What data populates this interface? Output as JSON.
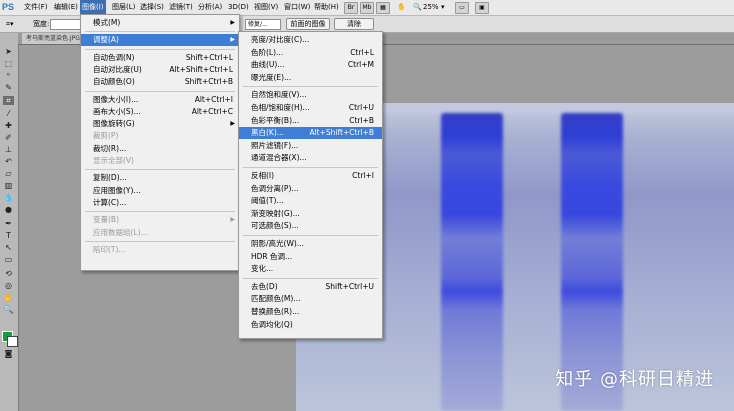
{
  "menubar": {
    "app_logo": "PS",
    "items": [
      {
        "label": "文件(F)"
      },
      {
        "label": "编辑(E)"
      },
      {
        "label": "图像(I)"
      },
      {
        "label": "图层(L)"
      },
      {
        "label": "选择(S)"
      },
      {
        "label": "滤镜(T)"
      },
      {
        "label": "分析(A)"
      },
      {
        "label": "3D(D)"
      },
      {
        "label": "视图(V)"
      },
      {
        "label": "窗口(W)"
      },
      {
        "label": "帮助(H)"
      }
    ],
    "zoom": "25%"
  },
  "options_bar": {
    "width_label": "宽度:",
    "style_value": "修复/...",
    "front_image_button": "前面的图像",
    "clear_button": "清除"
  },
  "document_tab": {
    "title": "考马斯亮蓝染色.JPG"
  },
  "image_menu": {
    "items": [
      {
        "label": "模式(M)",
        "shortcut": "",
        "submenu": true,
        "highlighted": false,
        "disabled": false
      },
      {
        "separator": true
      },
      {
        "label": "调整(A)",
        "shortcut": "",
        "submenu": true,
        "highlighted": true,
        "disabled": false
      },
      {
        "separator": true
      },
      {
        "label": "自动色调(N)",
        "shortcut": "Shift+Ctrl+L",
        "submenu": false,
        "highlighted": false,
        "disabled": false
      },
      {
        "label": "自动对比度(U)",
        "shortcut": "Alt+Shift+Ctrl+L",
        "submenu": false,
        "highlighted": false,
        "disabled": false
      },
      {
        "label": "自动颜色(O)",
        "shortcut": "Shift+Ctrl+B",
        "submenu": false,
        "highlighted": false,
        "disabled": false
      },
      {
        "separator": true
      },
      {
        "label": "图像大小(I)...",
        "shortcut": "Alt+Ctrl+I",
        "submenu": false,
        "highlighted": false,
        "disabled": false
      },
      {
        "label": "画布大小(S)...",
        "shortcut": "Alt+Ctrl+C",
        "submenu": false,
        "highlighted": false,
        "disabled": false
      },
      {
        "label": "图像旋转(G)",
        "shortcut": "",
        "submenu": true,
        "highlighted": false,
        "disabled": false
      },
      {
        "label": "裁剪(P)",
        "shortcut": "",
        "submenu": false,
        "highlighted": false,
        "disabled": true
      },
      {
        "label": "裁切(R)...",
        "shortcut": "",
        "submenu": false,
        "highlighted": false,
        "disabled": false
      },
      {
        "label": "显示全部(V)",
        "shortcut": "",
        "submenu": false,
        "highlighted": false,
        "disabled": true
      },
      {
        "separator": true
      },
      {
        "label": "复制(D)...",
        "shortcut": "",
        "submenu": false,
        "highlighted": false,
        "disabled": false
      },
      {
        "label": "应用图像(Y)...",
        "shortcut": "",
        "submenu": false,
        "highlighted": false,
        "disabled": false
      },
      {
        "label": "计算(C)...",
        "shortcut": "",
        "submenu": false,
        "highlighted": false,
        "disabled": false
      },
      {
        "separator": true
      },
      {
        "label": "变量(B)",
        "shortcut": "",
        "submenu": true,
        "highlighted": false,
        "disabled": true
      },
      {
        "label": "应用数据组(L)...",
        "shortcut": "",
        "submenu": false,
        "highlighted": false,
        "disabled": true
      },
      {
        "separator": true
      },
      {
        "label": "陷印(T)...",
        "shortcut": "",
        "submenu": false,
        "highlighted": false,
        "disabled": true
      }
    ]
  },
  "adjust_menu": {
    "items": [
      {
        "label": "亮度/对比度(C)...",
        "shortcut": "",
        "highlighted": false
      },
      {
        "label": "色阶(L)...",
        "shortcut": "Ctrl+L",
        "highlighted": false
      },
      {
        "label": "曲线(U)...",
        "shortcut": "Ctrl+M",
        "highlighted": false
      },
      {
        "label": "曝光度(E)...",
        "shortcut": "",
        "highlighted": false
      },
      {
        "separator": true
      },
      {
        "label": "自然饱和度(V)...",
        "shortcut": "",
        "highlighted": false
      },
      {
        "label": "色相/饱和度(H)...",
        "shortcut": "Ctrl+U",
        "highlighted": false
      },
      {
        "label": "色彩平衡(B)...",
        "shortcut": "Ctrl+B",
        "highlighted": false
      },
      {
        "label": "黑白(K)...",
        "shortcut": "Alt+Shift+Ctrl+B",
        "highlighted": true
      },
      {
        "label": "照片滤镜(F)...",
        "shortcut": "",
        "highlighted": false
      },
      {
        "label": "通道混合器(X)...",
        "shortcut": "",
        "highlighted": false
      },
      {
        "separator": true
      },
      {
        "label": "反相(I)",
        "shortcut": "Ctrl+I",
        "highlighted": false
      },
      {
        "label": "色调分离(P)...",
        "shortcut": "",
        "highlighted": false
      },
      {
        "label": "阈值(T)...",
        "shortcut": "",
        "highlighted": false
      },
      {
        "label": "渐变映射(G)...",
        "shortcut": "",
        "highlighted": false
      },
      {
        "label": "可选颜色(S)...",
        "shortcut": "",
        "highlighted": false
      },
      {
        "separator": true
      },
      {
        "label": "阴影/高光(W)...",
        "shortcut": "",
        "highlighted": false
      },
      {
        "label": "HDR 色调...",
        "shortcut": "",
        "highlighted": false
      },
      {
        "label": "变化...",
        "shortcut": "",
        "highlighted": false
      },
      {
        "separator": true
      },
      {
        "label": "去色(D)",
        "shortcut": "Shift+Ctrl+U",
        "highlighted": false
      },
      {
        "label": "匹配颜色(M)...",
        "shortcut": "",
        "highlighted": false
      },
      {
        "label": "替换颜色(R)...",
        "shortcut": "",
        "highlighted": false
      },
      {
        "label": "色调均化(Q)",
        "shortcut": "",
        "highlighted": false
      }
    ]
  },
  "watermark": "知乎 @科研日精进",
  "colors": {
    "highlight": "#3e7ed6",
    "foreground_swatch": "#1a9c3a",
    "gel_blue": "#2a38d8"
  }
}
